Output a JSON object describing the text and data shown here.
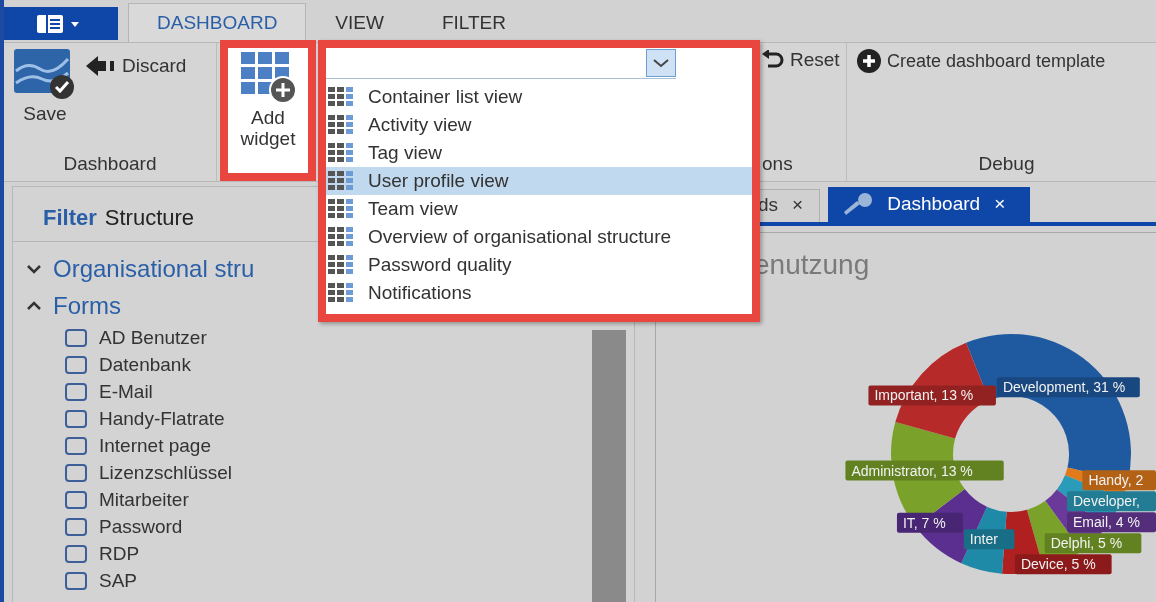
{
  "ribbon_tabs": [
    {
      "label": "DASHBOARD",
      "selected": true
    },
    {
      "label": "VIEW",
      "selected": false
    },
    {
      "label": "FILTER",
      "selected": false
    }
  ],
  "ribbon": {
    "save": "Save",
    "discard": "Discard",
    "add_widget": "Add widget",
    "reset": "Reset",
    "create_template": "Create dashboard template",
    "group_labels": [
      "Dashboard",
      "ons",
      "Debug"
    ]
  },
  "widget_dropdown": {
    "items": [
      {
        "label": "Container list view",
        "selected": false
      },
      {
        "label": "Activity view",
        "selected": false
      },
      {
        "label": "Tag view",
        "selected": false
      },
      {
        "label": "User profile view",
        "selected": true
      },
      {
        "label": "Team view",
        "selected": false
      },
      {
        "label": "Overview of organisational structure",
        "selected": false
      },
      {
        "label": "Password quality",
        "selected": false
      },
      {
        "label": "Notifications",
        "selected": false
      }
    ]
  },
  "filter_panel": {
    "tabs": [
      {
        "label": "Filter",
        "selected": true
      },
      {
        "label": "Structure",
        "selected": false
      }
    ],
    "tree": [
      {
        "label": "Organisational stru",
        "expanded": false
      },
      {
        "label": "Forms",
        "expanded": true,
        "children": [
          {
            "label": "AD Benutzer",
            "checked": false
          },
          {
            "label": "Datenbank",
            "checked": false
          },
          {
            "label": "E-Mail",
            "checked": false
          },
          {
            "label": "Handy-Flatrate",
            "checked": false
          },
          {
            "label": "Internet page",
            "checked": false
          },
          {
            "label": "Lizenzschlüssel",
            "checked": false
          },
          {
            "label": "Mitarbeiter",
            "checked": false
          },
          {
            "label": "Password",
            "checked": false
          },
          {
            "label": "RDP",
            "checked": false
          },
          {
            "label": "SAP",
            "checked": false
          }
        ]
      }
    ]
  },
  "document_tabs": [
    {
      "label": "ds",
      "close": "×",
      "selected": false
    },
    {
      "label": "Dashboard",
      "close": "×",
      "selected": true
    }
  ],
  "widget": {
    "title": "enutzung",
    "chart_data": {
      "type": "donut",
      "values": [
        31,
        2,
        4,
        4,
        5,
        5,
        5,
        7,
        13,
        13
      ],
      "colors": [
        "#1f5aa0",
        "#e07a1a",
        "#2a9bb8",
        "#6a3a9a",
        "#7aa22a",
        "#b02020",
        "#1e8aa8",
        "#5a2f90",
        "#7aa22a",
        "#b72a2a"
      ],
      "value_labels": [
        "Development, 31 %",
        "Handy, 2",
        "Developer,",
        "Email, 4 %",
        "Delphi, 5 %",
        "Device, 5 %",
        "Inter",
        "IT, 7 %",
        "Administrator, 13 %",
        "Important, 13 %"
      ]
    }
  }
}
